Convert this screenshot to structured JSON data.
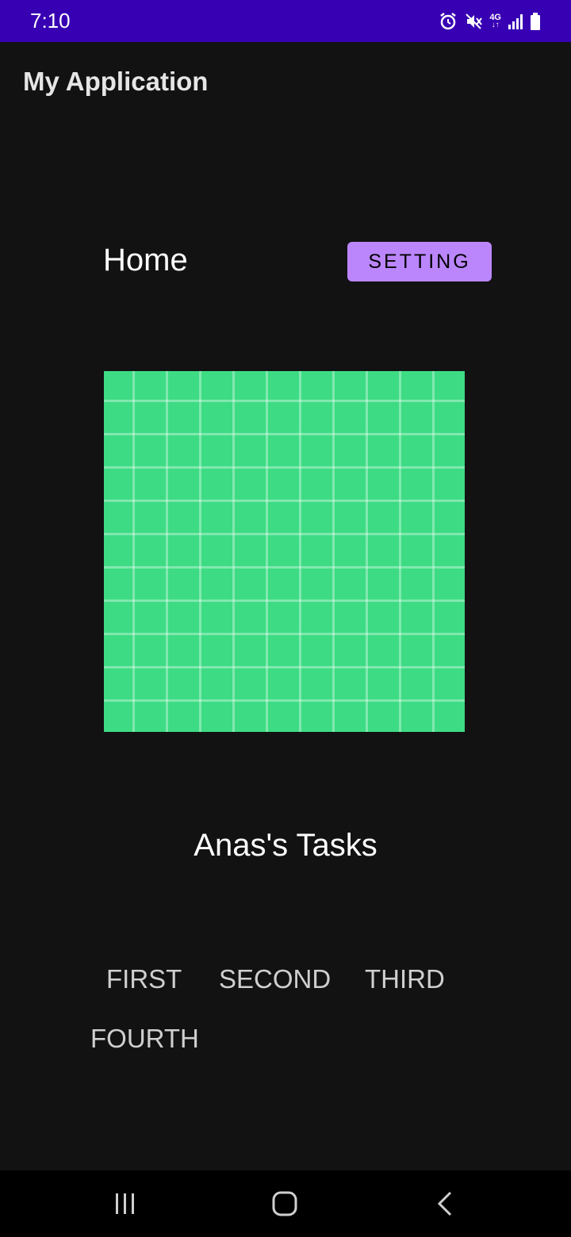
{
  "status_bar": {
    "time": "7:10",
    "network_label": "4G",
    "bg_color": "#3700b3"
  },
  "app_bar": {
    "title": "My Application"
  },
  "home": {
    "label": "Home",
    "setting_button": "SETTING"
  },
  "image": {
    "color": "#3ddc84"
  },
  "tasks": {
    "title": "Anas's Tasks",
    "buttons": [
      "FIRST",
      "SECOND",
      "THIRD",
      "FOURTH"
    ]
  },
  "colors": {
    "background": "#121212",
    "accent": "#bb86fc"
  }
}
